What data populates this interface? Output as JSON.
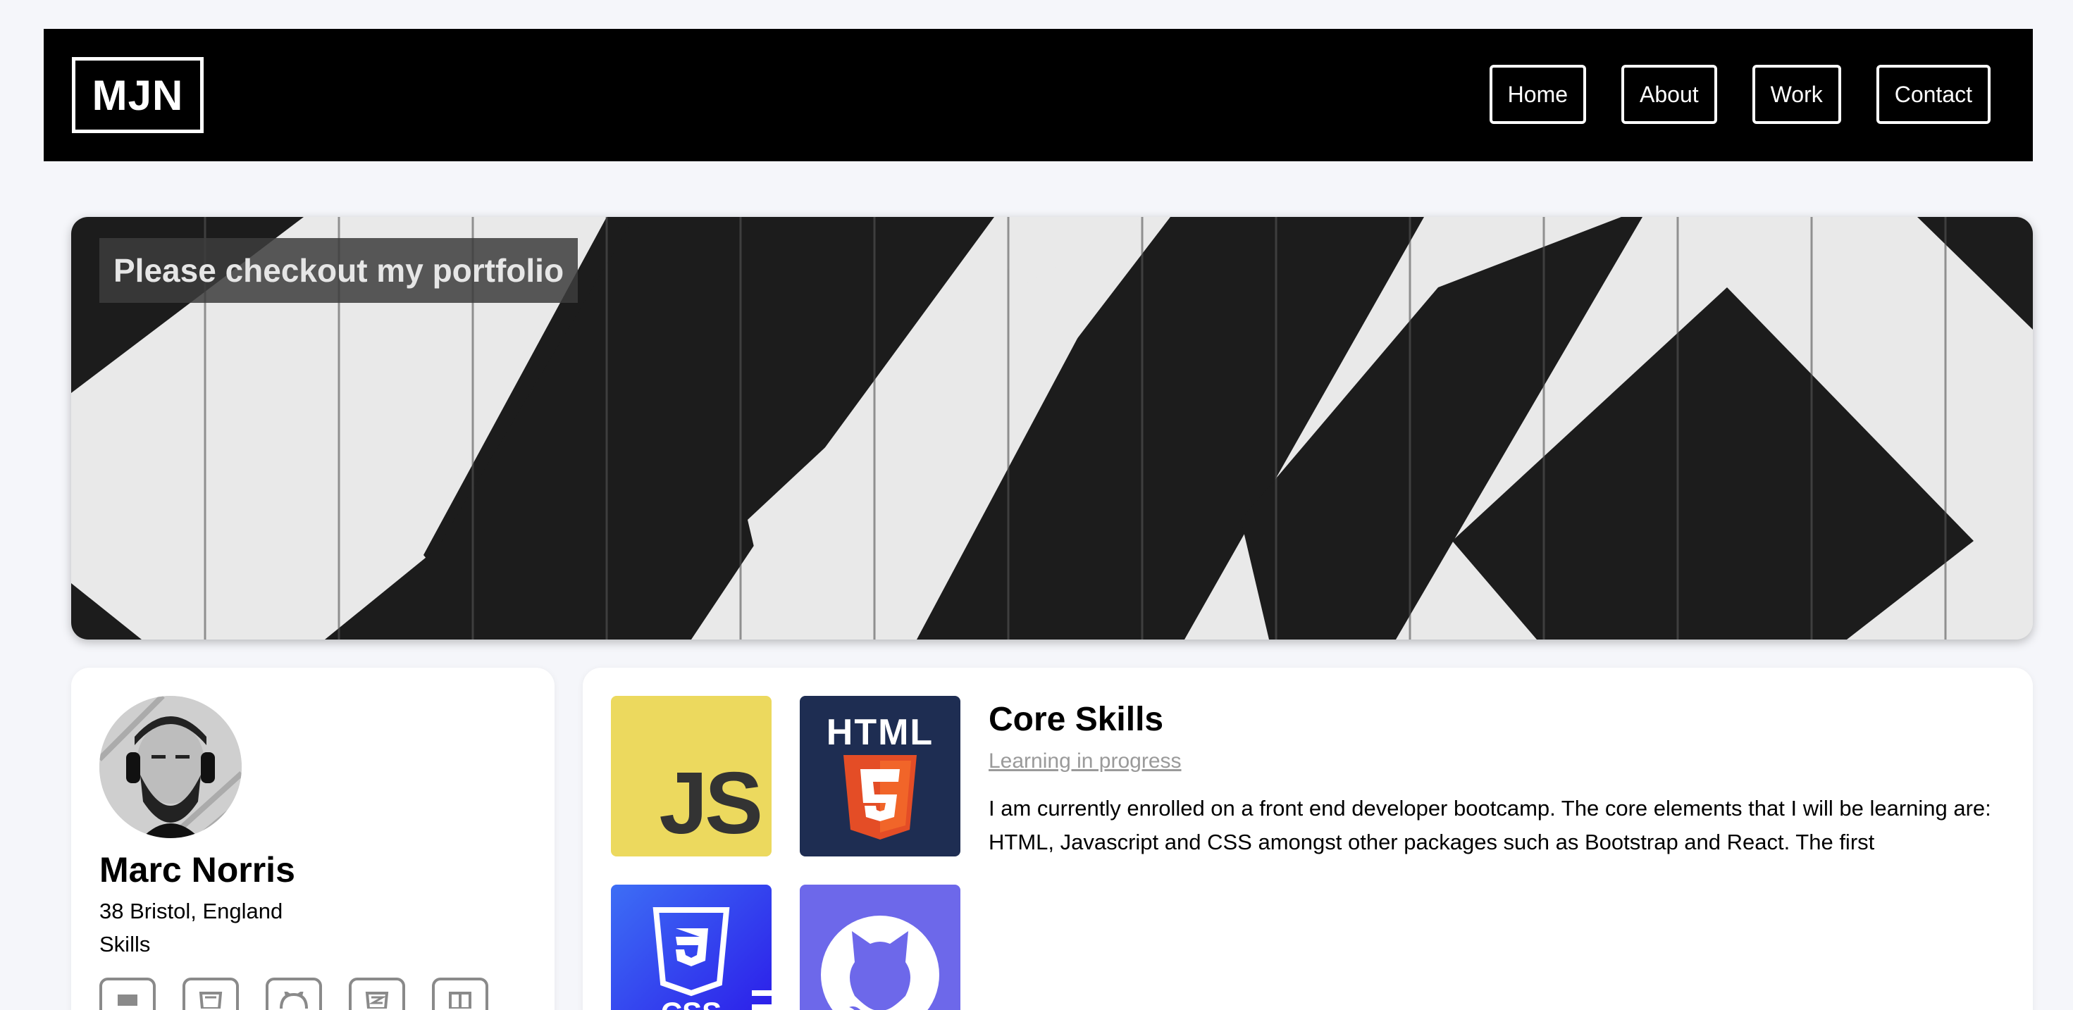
{
  "nav": {
    "logo": "MJN",
    "links": [
      "Home",
      "About",
      "Work",
      "Contact"
    ]
  },
  "hero": {
    "caption": "Please checkout my portfolio"
  },
  "profile": {
    "name": "Marc Norris",
    "location": "38 Bristol, England",
    "skills_label": "Skills",
    "skill_icons": [
      "javascript-icon",
      "html5-icon",
      "github-icon",
      "css3-icon",
      "bootstrap-icon"
    ]
  },
  "skills": {
    "tiles": [
      "JS",
      "HTML",
      "CSS"
    ],
    "title": "Core Skills",
    "subtitle": "Learning in progress",
    "body": "I am currently enrolled on a front end developer bootcamp. The core elements that I will be learning are: HTML, Javascript and CSS amongst other packages such as Bootstrap and React. The first"
  },
  "colors": {
    "nav_bg": "#000000",
    "page_bg": "#f5f6fa",
    "js_tile": "#ecd95e",
    "html_tile": "#1e2d52",
    "html_shield": "#e44d26",
    "css_tile": "#2a16e8",
    "github_tile": "#6d68ea"
  }
}
